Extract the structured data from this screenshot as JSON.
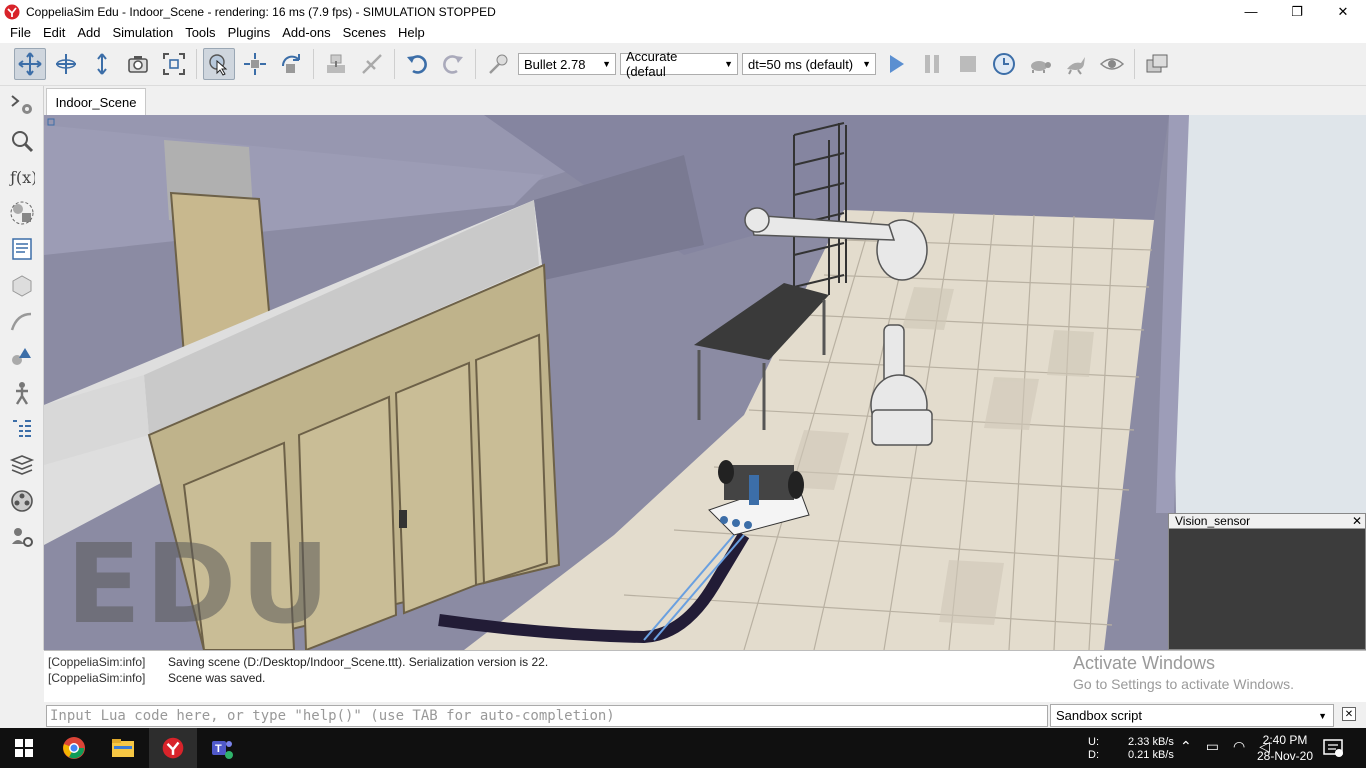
{
  "window": {
    "title": "CoppeliaSim Edu - Indoor_Scene - rendering: 16 ms (7.9 fps) - SIMULATION STOPPED",
    "minimize": "—",
    "restore": "❐",
    "close": "✕"
  },
  "menu": [
    "File",
    "Edit",
    "Add",
    "Simulation",
    "Tools",
    "Plugins",
    "Add-ons",
    "Scenes",
    "Help"
  ],
  "toolbar": {
    "engine": "Bullet 2.78",
    "accuracy": "Accurate (defaul",
    "timestep": "dt=50 ms (default)",
    "icons": [
      "camera-pan-icon",
      "camera-rotate-icon",
      "camera-shift-icon",
      "camera-angle-icon",
      "fit-to-view-icon",
      "click-select-icon",
      "object-shift-icon",
      "object-rotate-icon",
      "assemble-icon",
      "transfer-dna-icon",
      "undo-icon",
      "redo-icon",
      "dynamics-icon",
      "start-simulation-icon",
      "pause-simulation-icon",
      "stop-simulation-icon",
      "realtime-icon",
      "slow-down-icon",
      "speed-up-icon",
      "visualization-toggle-icon",
      "page-selector-icon"
    ]
  },
  "left_toolbar": [
    "scene-object-properties-icon",
    "calculation-modules-icon",
    "math-function-icon",
    "collections-icon",
    "scripts-icon",
    "shape-edit-icon",
    "path-edit-icon",
    "selection-icon",
    "model-browser-icon",
    "scene-hierarchy-icon",
    "layers-icon",
    "video-recorder-icon",
    "user-settings-icon"
  ],
  "scene_tab": "Indoor_Scene",
  "viewport": {
    "watermark": "EDU",
    "vision_sensor_title": "Vision_sensor",
    "vision_sensor_close": "✕"
  },
  "console": [
    {
      "tag": "[CoppeliaSim:info]",
      "msg": "Saving scene (D:/Desktop/Indoor_Scene.ttt). Serialization version is 22."
    },
    {
      "tag": "[CoppeliaSim:info]",
      "msg": "Scene was saved."
    }
  ],
  "activation": {
    "line1": "Activate Windows",
    "line2": "Go to Settings to activate Windows."
  },
  "command": {
    "placeholder": "Input Lua code here, or type \"help()\" (use TAB for auto-completion)",
    "script": "Sandbox script",
    "close": "✕"
  },
  "taskbar": {
    "apps": [
      "windows-start-icon",
      "chrome-icon",
      "file-explorer-icon",
      "coppeliasim-icon",
      "teams-icon"
    ],
    "upload_label": "U:",
    "upload": "2.33 kB/s",
    "download_label": "D:",
    "download": "0.21 kB/s",
    "time": "2:40 PM",
    "date": "28-Nov-20"
  },
  "colors": {
    "wall": "#8b8ba3",
    "floor_light": "#e6dfd2",
    "cabinet": "#c7bc96",
    "accent": "#3c6ea8"
  }
}
